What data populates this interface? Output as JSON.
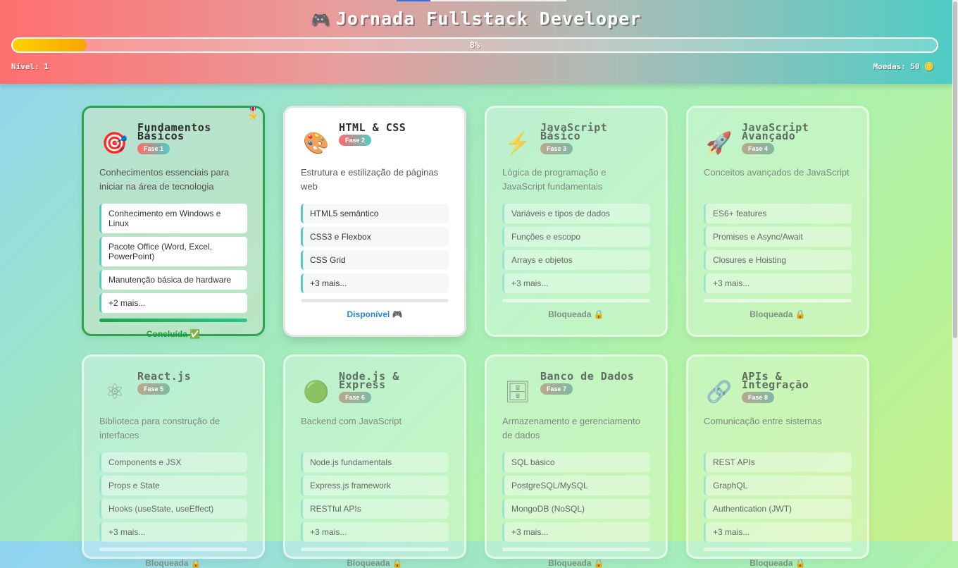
{
  "header": {
    "title": "Jornada Fullstack Developer",
    "title_icon": "🎮",
    "progress_label": "8%",
    "progress_value": 0.08,
    "level_label": "Nível: 1",
    "coins_label": "Moedas: 50 🪙"
  },
  "cards": [
    {
      "icon": "target-icon",
      "glyph": "🎯",
      "title": "Fundamentos Básicos",
      "phase": "Fase 1",
      "desc": "Conhecimentos essenciais para iniciar na área de tecnologia",
      "topics": [
        "Conhecimento em Windows e Linux",
        "Pacote Office (Word, Excel, PowerPoint)",
        "Manutenção básica de hardware",
        "+2 mais..."
      ],
      "status": "Concluída ✅",
      "state": "done",
      "corner": "🎖️"
    },
    {
      "icon": "palette-icon",
      "glyph": "🎨",
      "title": "HTML & CSS",
      "phase": "Fase 2",
      "desc": "Estrutura e estilização de páginas web",
      "topics": [
        "HTML5 semântico",
        "CSS3 e Flexbox",
        "CSS Grid",
        "+3 mais..."
      ],
      "status": "Disponível 🎮",
      "state": "available"
    },
    {
      "icon": "lightning-icon",
      "glyph": "⚡",
      "title": "JavaScript Básico",
      "phase": "Fase 3",
      "desc": "Lógica de programação e JavaScript fundamentais",
      "topics": [
        "Variáveis e tipos de dados",
        "Funções e escopo",
        "Arrays e objetos",
        "+3 mais..."
      ],
      "status": "Bloqueada 🔒",
      "state": "locked"
    },
    {
      "icon": "rocket-icon",
      "glyph": "🚀",
      "title": "JavaScript Avançado",
      "phase": "Fase 4",
      "desc": "Conceitos avançados de JavaScript",
      "topics": [
        "ES6+ features",
        "Promises e Async/Await",
        "Closures e Hoisting",
        "+3 mais..."
      ],
      "status": "Bloqueada 🔒",
      "state": "locked"
    },
    {
      "icon": "atom-icon",
      "glyph": "⚛",
      "title": "React.js",
      "phase": "Fase 5",
      "desc": "Biblioteca para construção de interfaces",
      "topics": [
        "Components e JSX",
        "Props e State",
        "Hooks (useState, useEffect)",
        "+3 mais..."
      ],
      "status": "Bloqueada 🔒",
      "state": "locked"
    },
    {
      "icon": "green-circle-icon",
      "glyph": "🟢",
      "title": "Node.js & Express",
      "phase": "Fase 6",
      "desc": "Backend com JavaScript",
      "topics": [
        "Node.js fundamentals",
        "Express.js framework",
        "RESTful APIs",
        "+3 mais..."
      ],
      "status": "Bloqueada 🔒",
      "state": "locked"
    },
    {
      "icon": "database-icon",
      "glyph": "🗄",
      "title": "Banco de Dados",
      "phase": "Fase 7",
      "desc": "Armazenamento e gerenciamento de dados",
      "topics": [
        "SQL básico",
        "PostgreSQL/MySQL",
        "MongoDB (NoSQL)",
        "+3 mais..."
      ],
      "status": "Bloqueada 🔒",
      "state": "locked"
    },
    {
      "icon": "link-icon",
      "glyph": "🔗",
      "title": "APIs & Integração",
      "phase": "Fase 8",
      "desc": "Comunicação entre sistemas",
      "topics": [
        "REST APIs",
        "GraphQL",
        "Authentication (JWT)",
        "+3 mais..."
      ],
      "status": "Bloqueada 🔒",
      "state": "locked"
    }
  ]
}
